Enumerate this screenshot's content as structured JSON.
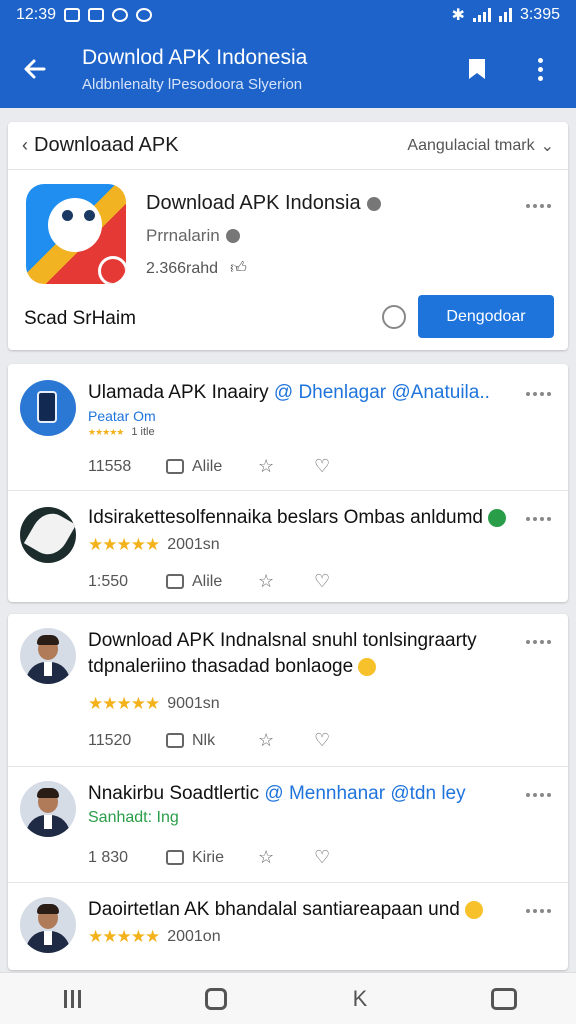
{
  "status_bar": {
    "time": "12:39",
    "right_time": "3:395"
  },
  "app_bar": {
    "title": "Downlod APK Indonesia",
    "subtitle": "Aldbnlenalty lPesodoora Slyerion"
  },
  "app_card": {
    "breadcrumb": "Downloaad APK",
    "filter": "Aangulacial tmark",
    "app_name": "Download APK Indonsia",
    "category": "Prrnalarin",
    "downloads": "2.366rahd",
    "scan_label": "Scad SrHaim",
    "download_button": "Dengodoar"
  },
  "posts": [
    {
      "title": "Ulamada APK Inaairy",
      "mention": "@ Dhenlagar @Anatuila..",
      "sub": "Peatar Om",
      "meta": "1 itle",
      "count": "11558",
      "comment": "Alile",
      "avatar": "phone-avatar"
    },
    {
      "title": "Idsirakettesolfennaika beslars Ombas anldumd",
      "meta": "2001sn",
      "count": "1:550",
      "comment": "Alile",
      "avatar": "leaf-avatar"
    },
    {
      "title": "Download APK Indnalsnal snuhl tonlsingraarty tdpnaleriino thasadad bonlaoge",
      "meta": "9001sn",
      "count": "11520",
      "comment": "Nlk",
      "avatar": "person-avatar"
    },
    {
      "title": "Nnakirbu Soadtlertic",
      "mention": "@ Mennhanar @tdn ley",
      "sub": "Sanhadt: Ing",
      "count": "1 830",
      "comment": "Kirie",
      "avatar": "person-avatar"
    },
    {
      "title": "Daoirtetlan AK bhandalal santiareapaan",
      "title_end": "und",
      "meta": "2001on",
      "avatar": "person-avatar"
    }
  ],
  "colors": {
    "primary": "#1d63c9",
    "button": "#1f74dc",
    "star": "#f3b21b"
  },
  "icons": [
    "back-arrow-icon",
    "bookmark-icon",
    "more-vert-icon",
    "chevron-left-icon",
    "chevron-down-icon",
    "info-icon",
    "like-icon",
    "refresh-icon",
    "comment-icon",
    "star-icon",
    "heart-icon",
    "recents-icon",
    "home-icon",
    "back-icon",
    "camera-icon"
  ]
}
